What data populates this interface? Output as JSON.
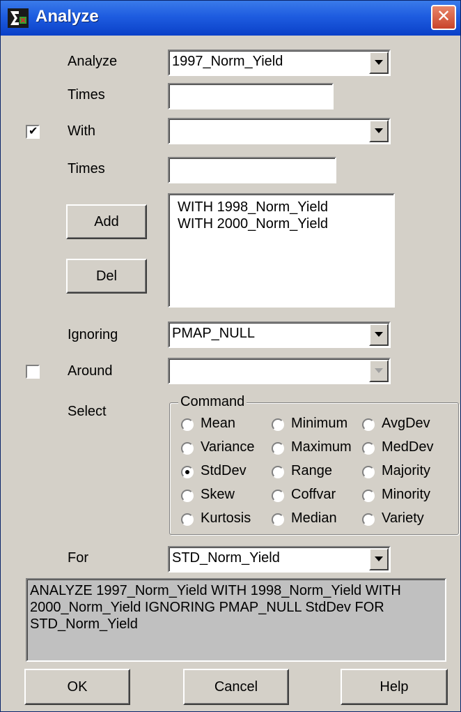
{
  "window": {
    "title": "Analyze",
    "close_glyph": "✕"
  },
  "labels": {
    "analyze": "Analyze",
    "times1": "Times",
    "with": "With",
    "times2": "Times",
    "ignoring": "Ignoring",
    "around": "Around",
    "select": "Select",
    "for": "For"
  },
  "fields": {
    "analyze_value": "1997_Norm_Yield",
    "times1_value": "",
    "with_value": "",
    "times2_value": "",
    "ignoring_value": "PMAP_NULL",
    "around_value": "",
    "for_value": "STD_Norm_Yield"
  },
  "checkboxes": {
    "with_checked": true,
    "around_checked": false,
    "check_glyph": "✔"
  },
  "buttons": {
    "add": "Add",
    "del": "Del",
    "ok": "OK",
    "cancel": "Cancel",
    "help": "Help"
  },
  "with_list": [
    "WITH 1998_Norm_Yield",
    "WITH 2000_Norm_Yield"
  ],
  "command": {
    "legend": "Command",
    "selected": "StdDev",
    "rows": [
      [
        "Mean",
        "Minimum",
        "AvgDev"
      ],
      [
        "Variance",
        "Maximum",
        "MedDev"
      ],
      [
        "StdDev",
        "Range",
        "Majority"
      ],
      [
        "Skew",
        "Coffvar",
        "Minority"
      ],
      [
        "Kurtosis",
        "Median",
        "Variety"
      ]
    ]
  },
  "summary_text": "ANALYZE 1997_Norm_Yield WITH 1998_Norm_Yield WITH 2000_Norm_Yield IGNORING PMAP_NULL StdDev FOR STD_Norm_Yield",
  "colors": {
    "titlebar": "#1e5ce0",
    "dialog_bg": "#d4d0c8",
    "close_button": "#c9442a",
    "summary_bg": "#c0c0c0"
  },
  "icons": {
    "app_icon": "analyze-app-icon",
    "close": "close-icon",
    "dropdown": "chevron-down-icon"
  }
}
